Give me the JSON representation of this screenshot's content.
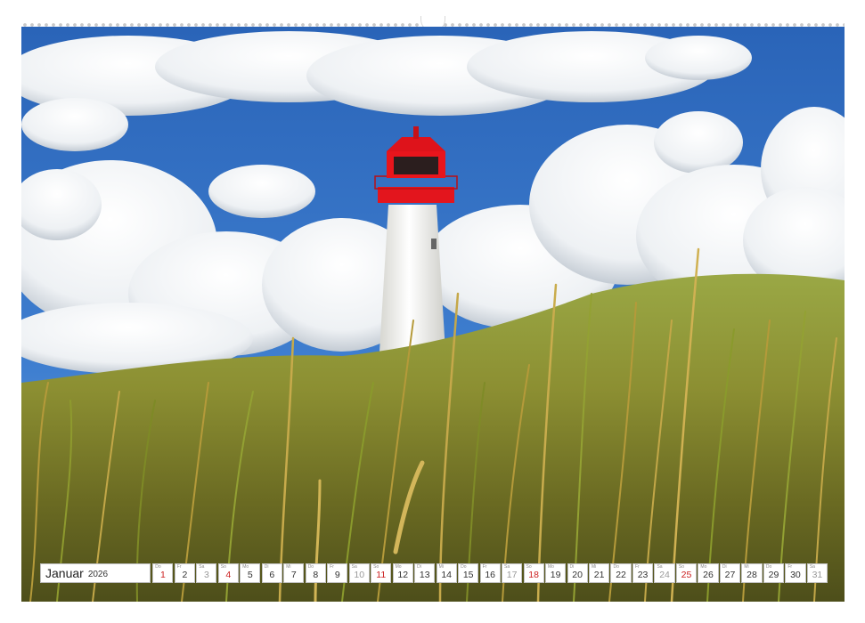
{
  "calendar": {
    "month": "Januar",
    "year": "2026",
    "days": [
      {
        "day": "1",
        "weekday": "Do",
        "type": "holiday"
      },
      {
        "day": "2",
        "weekday": "Fr",
        "type": "normal"
      },
      {
        "day": "3",
        "weekday": "Sa",
        "type": "weekend"
      },
      {
        "day": "4",
        "weekday": "So",
        "type": "sunday"
      },
      {
        "day": "5",
        "weekday": "Mo",
        "type": "normal"
      },
      {
        "day": "6",
        "weekday": "Di",
        "type": "normal"
      },
      {
        "day": "7",
        "weekday": "Mi",
        "type": "normal"
      },
      {
        "day": "8",
        "weekday": "Do",
        "type": "normal"
      },
      {
        "day": "9",
        "weekday": "Fr",
        "type": "normal"
      },
      {
        "day": "10",
        "weekday": "Sa",
        "type": "weekend"
      },
      {
        "day": "11",
        "weekday": "So",
        "type": "sunday"
      },
      {
        "day": "12",
        "weekday": "Mo",
        "type": "normal"
      },
      {
        "day": "13",
        "weekday": "Di",
        "type": "normal"
      },
      {
        "day": "14",
        "weekday": "Mi",
        "type": "normal"
      },
      {
        "day": "15",
        "weekday": "Do",
        "type": "normal"
      },
      {
        "day": "16",
        "weekday": "Fr",
        "type": "normal"
      },
      {
        "day": "17",
        "weekday": "Sa",
        "type": "weekend"
      },
      {
        "day": "18",
        "weekday": "So",
        "type": "sunday"
      },
      {
        "day": "19",
        "weekday": "Mo",
        "type": "normal"
      },
      {
        "day": "20",
        "weekday": "Di",
        "type": "normal"
      },
      {
        "day": "21",
        "weekday": "Mi",
        "type": "normal"
      },
      {
        "day": "22",
        "weekday": "Do",
        "type": "normal"
      },
      {
        "day": "23",
        "weekday": "Fr",
        "type": "normal"
      },
      {
        "day": "24",
        "weekday": "Sa",
        "type": "weekend"
      },
      {
        "day": "25",
        "weekday": "So",
        "type": "sunday"
      },
      {
        "day": "26",
        "weekday": "Mo",
        "type": "normal"
      },
      {
        "day": "27",
        "weekday": "Di",
        "type": "normal"
      },
      {
        "day": "28",
        "weekday": "Mi",
        "type": "normal"
      },
      {
        "day": "29",
        "weekday": "Do",
        "type": "normal"
      },
      {
        "day": "30",
        "weekday": "Fr",
        "type": "normal"
      },
      {
        "day": "31",
        "weekday": "Sa",
        "type": "weekend"
      }
    ]
  },
  "colors": {
    "sky": "#2f6fc4",
    "sky_light": "#5b95d8",
    "cloud": "#f4f6f8",
    "cloud_shadow": "#b9c2cc",
    "tower": "#f2f2ee",
    "lantern_red": "#d7141c",
    "grass_dark": "#5f6a1c",
    "grass_gold": "#b59a3a",
    "grass_green": "#8a9a2c",
    "sunday_red": "#cc1f1f"
  },
  "icons": [
    "calendar-hanger-icon"
  ]
}
